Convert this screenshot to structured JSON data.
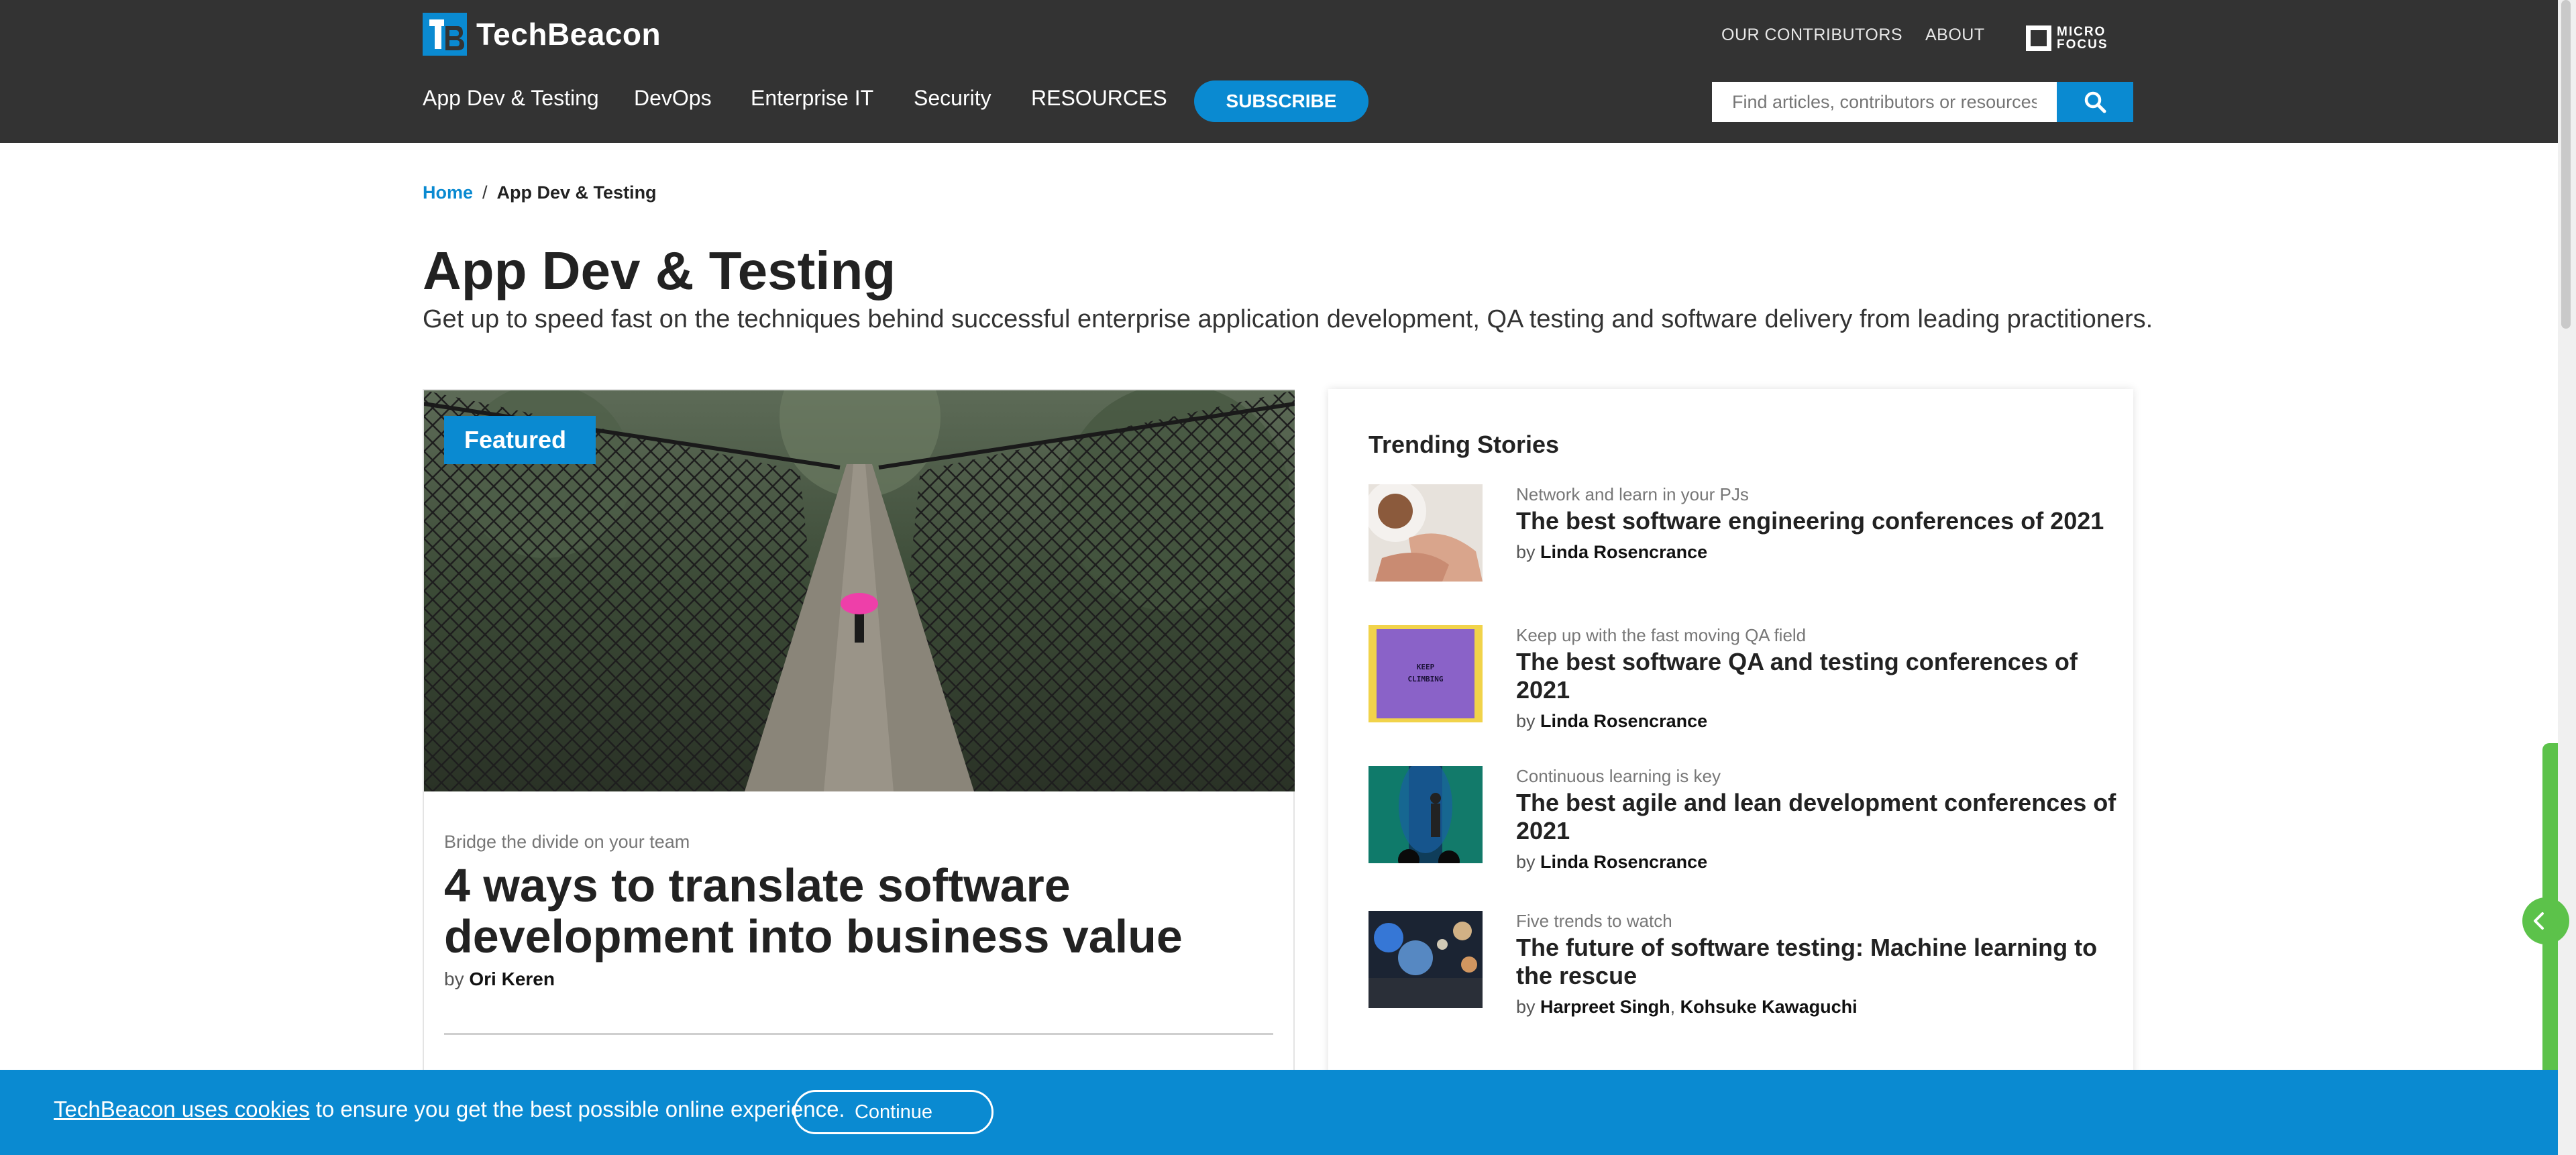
{
  "header": {
    "logo_text": "TechBeacon",
    "top_links": [
      "OUR CONTRIBUTORS",
      "ABOUT"
    ],
    "microfocus_line1": "MICRO",
    "microfocus_line2": "FOCUS",
    "nav": [
      "App Dev & Testing",
      "DevOps",
      "Enterprise IT",
      "Security",
      "RESOURCES"
    ],
    "subscribe_label": "SUBSCRIBE",
    "search_placeholder": "Find articles, contributors or resources"
  },
  "breadcrumb": {
    "home": "Home",
    "separator": "/",
    "current": "App Dev & Testing"
  },
  "page": {
    "title": "App Dev & Testing",
    "description": "Get up to speed fast on the techniques behind successful enterprise application development, QA testing and software delivery from leading practitioners."
  },
  "featured": {
    "badge": "Featured",
    "kicker": "Bridge the divide on your team",
    "headline": "4 ways to translate software development into business value",
    "by": "by",
    "author": "Ori Keren"
  },
  "trending": {
    "heading": "Trending Stories",
    "items": [
      {
        "kicker": "Network and learn in your PJs",
        "title": "The best software engineering conferences of 2021",
        "by": "by",
        "authors": "Linda Rosencrance"
      },
      {
        "kicker": "Keep up with the fast moving QA field",
        "title": "The best software QA and testing conferences of 2021",
        "by": "by",
        "authors": "Linda Rosencrance",
        "thumb_text": "KEEP CLIMBING"
      },
      {
        "kicker": "Continuous learning is key",
        "title": "The best agile and lean development conferences of 2021",
        "by": "by",
        "authors": "Linda Rosencrance"
      },
      {
        "kicker": "Five trends to watch",
        "title": "The future of software testing: Machine learning to the rescue",
        "by": "by",
        "author1": "Harpreet Singh",
        "author_sep": ",",
        "author2": "Kohsuke Kawaguchi"
      }
    ]
  },
  "cookie": {
    "link_text": "TechBeacon uses cookies",
    "rest_text": " to ensure you get the best possible online experience.",
    "button_label": "Continue"
  },
  "colors": {
    "header_bg": "#333333",
    "accent": "#0a8ad1",
    "green_tab": "#5cc24a"
  }
}
